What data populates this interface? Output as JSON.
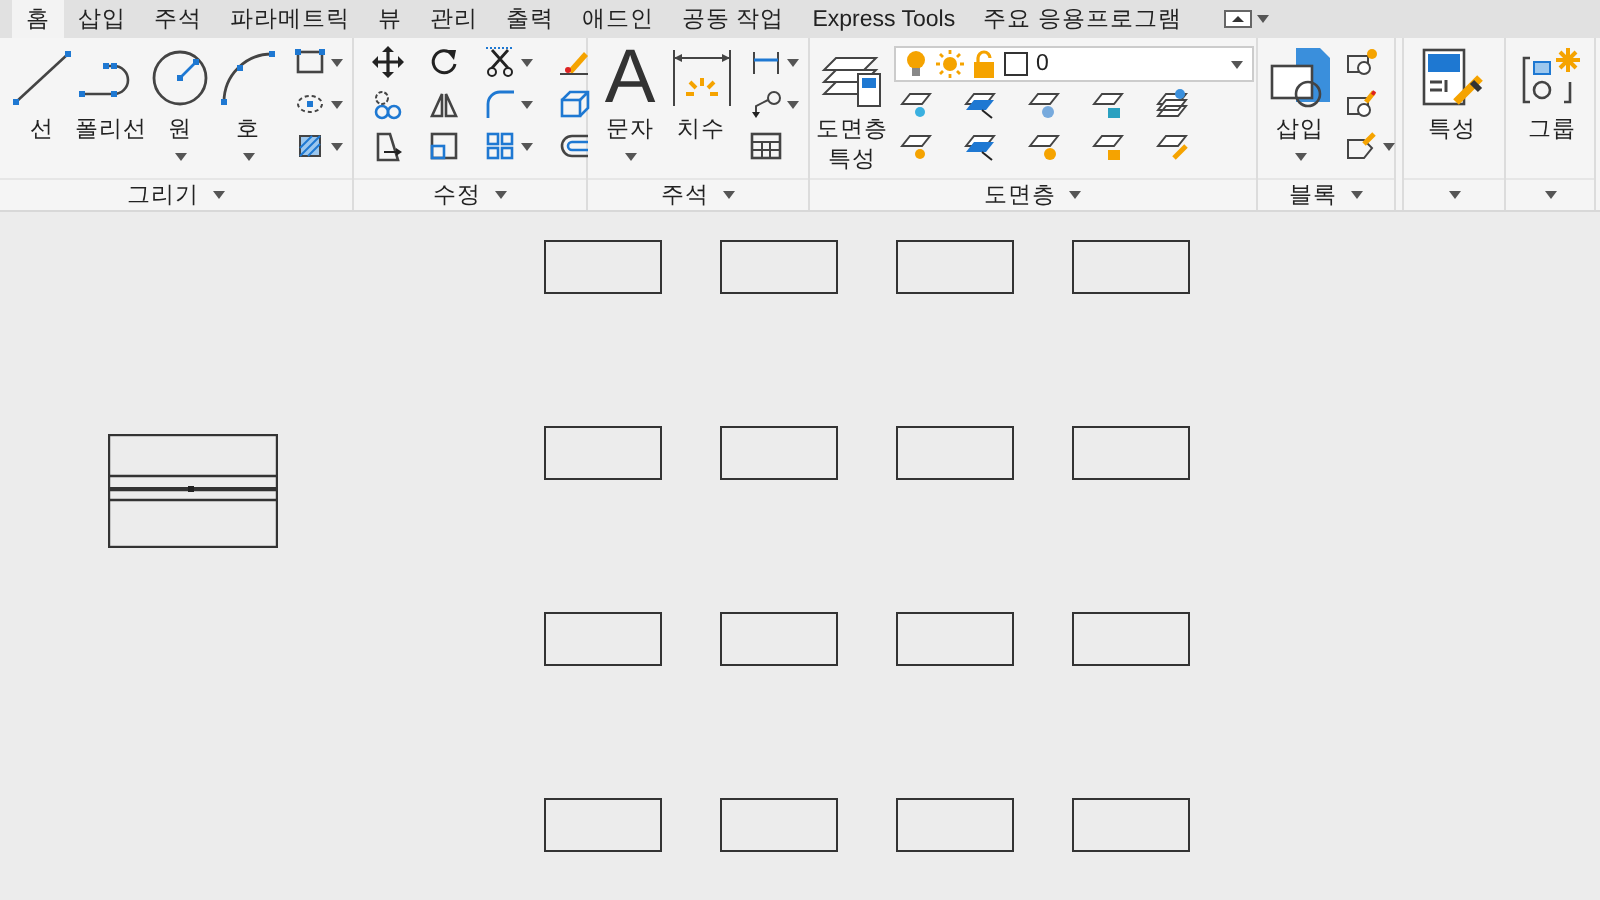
{
  "tabs": [
    {
      "label": "홈",
      "selected": true
    },
    {
      "label": "삽입",
      "selected": false
    },
    {
      "label": "주석",
      "selected": false
    },
    {
      "label": "파라메트릭",
      "selected": false
    },
    {
      "label": "뷰",
      "selected": false
    },
    {
      "label": "관리",
      "selected": false
    },
    {
      "label": "출력",
      "selected": false
    },
    {
      "label": "애드인",
      "selected": false
    },
    {
      "label": "공동 작업",
      "selected": false
    },
    {
      "label": "Express Tools",
      "selected": false
    },
    {
      "label": "주요 응용프로그램",
      "selected": false
    }
  ],
  "ribbon": {
    "panels": [
      {
        "title": "그리기",
        "big_buttons": [
          {
            "label": "선",
            "has_menu": false
          },
          {
            "label": "폴리선",
            "has_menu": false
          },
          {
            "label": "원",
            "has_menu": true
          },
          {
            "label": "호",
            "has_menu": true
          }
        ]
      },
      {
        "title": "수정"
      },
      {
        "title": "주석",
        "big_buttons": [
          {
            "label": "문자",
            "has_menu": true,
            "glyph": "A"
          },
          {
            "label": "치수",
            "has_menu": false
          }
        ]
      },
      {
        "title": "도면층",
        "big_buttons": [
          {
            "label": "도면층 특성",
            "has_menu": false
          }
        ],
        "layer_dropdown": {
          "value": "0"
        }
      },
      {
        "title": "블록",
        "big_buttons": [
          {
            "label": "삽입",
            "has_menu": true
          }
        ]
      },
      {
        "big_buttons": [
          {
            "label": "특성",
            "has_menu": false
          }
        ]
      },
      {
        "big_buttons": [
          {
            "label": "그룹",
            "has_menu": false
          }
        ]
      }
    ]
  }
}
